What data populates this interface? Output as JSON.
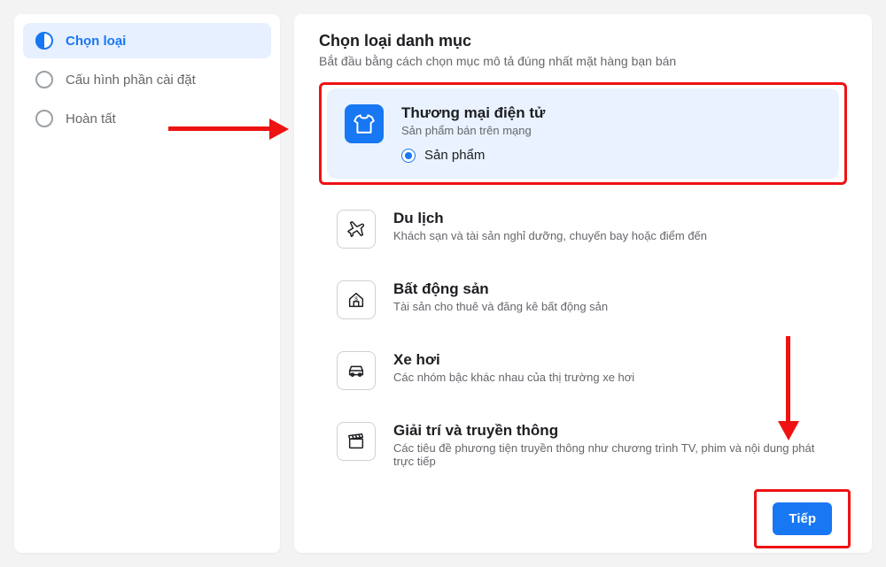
{
  "sidebar": {
    "steps": [
      {
        "label": "Chọn loại",
        "state": "active"
      },
      {
        "label": "Cấu hình phần cài đặt",
        "state": "pending"
      },
      {
        "label": "Hoàn tất",
        "state": "pending"
      }
    ]
  },
  "main": {
    "heading": "Chọn loại danh mục",
    "subheading": "Bắt đầu bằng cách chọn mục mô tả đúng nhất mặt hàng bạn bán",
    "categories": [
      {
        "title": "Thương mại điện tử",
        "desc": "Sản phẩm bán trên mạng",
        "icon": "tshirt-icon",
        "selected": true,
        "radio_option_label": "Sản phẩm"
      },
      {
        "title": "Du lịch",
        "desc": "Khách sạn và tài sản nghỉ dưỡng, chuyến bay hoặc điểm đến",
        "icon": "plane-icon",
        "selected": false
      },
      {
        "title": "Bất động sản",
        "desc": "Tài sản cho thuê và đăng kê bất động sản",
        "icon": "house-icon",
        "selected": false
      },
      {
        "title": "Xe hơi",
        "desc": "Các nhóm bậc khác nhau của thị trường xe hơi",
        "icon": "car-icon",
        "selected": false
      },
      {
        "title": "Giải trí và truyền thông",
        "desc": "Các tiêu đề phương tiện truyền thông như chương trình TV, phim và nội dung phát trực tiếp",
        "icon": "clapper-icon",
        "selected": false
      }
    ],
    "next_button": "Tiếp"
  },
  "colors": {
    "accent": "#1877f2",
    "annotation": "#ee1212"
  }
}
